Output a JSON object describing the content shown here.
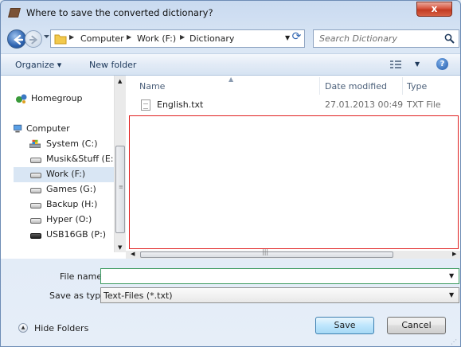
{
  "window": {
    "title": "Where to save the converted dictionary?",
    "close_label": "x"
  },
  "address": {
    "crumbs": [
      "Computer",
      "Work (F:)",
      "Dictionary"
    ],
    "search_placeholder": "Search Dictionary"
  },
  "toolbar": {
    "organize_label": "Organize ▾",
    "new_folder_label": "New folder"
  },
  "nav": {
    "items": [
      {
        "label": "Homegroup",
        "icon": "homegroup-icon"
      },
      {
        "label": "Computer",
        "icon": "computer-icon"
      },
      {
        "label": "System (C:)",
        "icon": "system-drive-icon"
      },
      {
        "label": "Musik&Stuff (E:)",
        "icon": "drive-icon"
      },
      {
        "label": "Work (F:)",
        "icon": "drive-icon",
        "selected": true
      },
      {
        "label": "Games (G:)",
        "icon": "drive-icon"
      },
      {
        "label": "Backup (H:)",
        "icon": "drive-icon"
      },
      {
        "label": "Hyper (O:)",
        "icon": "drive-icon"
      },
      {
        "label": "USB16GB (P:)",
        "icon": "usb-drive-icon"
      }
    ]
  },
  "files": {
    "columns": [
      "Name",
      "Date modified",
      "Type"
    ],
    "rows": [
      {
        "name": "English.txt",
        "date_modified": "27.01.2013 00:49",
        "type": "TXT File"
      }
    ]
  },
  "form": {
    "file_name_label": "File name:",
    "file_name_value": "",
    "save_type_label": "Save as type:",
    "save_type_value": "Text-Files (*.txt)"
  },
  "footer": {
    "hide_folders_label": "Hide Folders",
    "save_label": "Save",
    "cancel_label": "Cancel"
  },
  "colors": {
    "highlight_border": "#e02020",
    "selection_bg": "#d9e6f4",
    "filename_border": "#3c9a5f"
  }
}
